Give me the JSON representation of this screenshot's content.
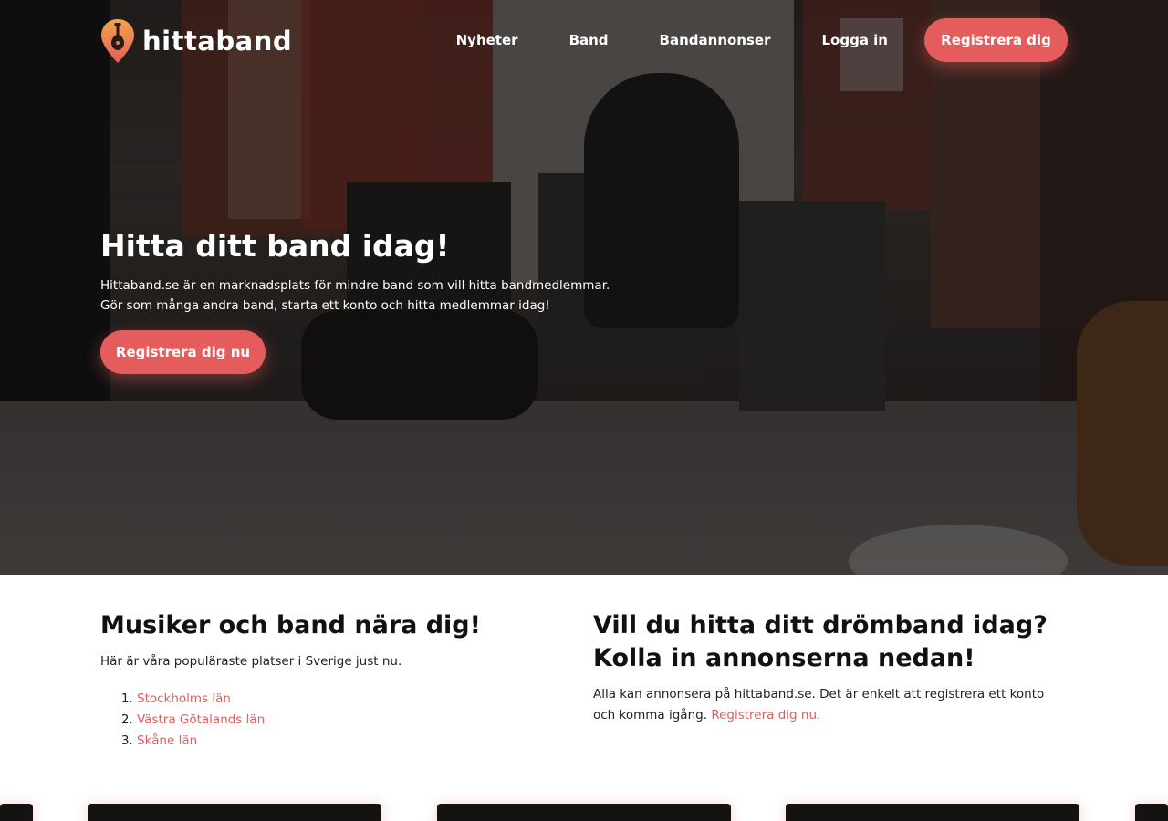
{
  "brand": {
    "name": "hittaband",
    "accent_color": "#e55c5c",
    "logo_icon": "guitar-pin-icon"
  },
  "nav": {
    "items": [
      {
        "label": "Nyheter"
      },
      {
        "label": "Band"
      },
      {
        "label": "Bandannonser"
      },
      {
        "label": "Logga in"
      }
    ],
    "cta_label": "Registrera dig"
  },
  "hero": {
    "title": "Hitta ditt band idag!",
    "line1": "Hittaband.se är en marknadsplats för mindre band som vill hitta bandmedlemmar.",
    "line2": "Gör som många andra band, starta ett konto och hitta medlemmar idag!",
    "cta_label": "Registrera dig nu"
  },
  "nearby": {
    "title": "Musiker och band nära dig!",
    "text": "Här är våra populäraste platser i Sverige just nu.",
    "places": [
      "Stockholms län",
      "Västra Götalands län",
      "Skåne län"
    ]
  },
  "ads": {
    "title_line1": "Vill du hitta ditt drömband idag?",
    "title_line2": "Kolla in annonserna nedan!",
    "text": "Alla kan annonsera på hittaband.se. Det är enkelt att registrera ett konto och komma igång.",
    "link_label": "Registrera dig nu."
  }
}
